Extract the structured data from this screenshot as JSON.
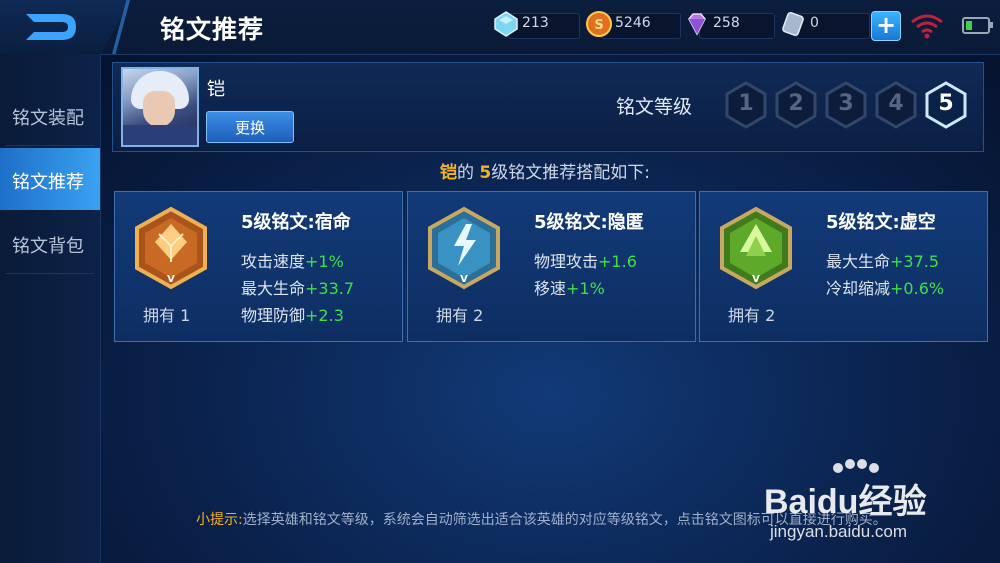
{
  "header": {
    "title": "铭文推荐",
    "resources": [
      {
        "icon": "diamond-icon",
        "value": "213"
      },
      {
        "icon": "gold-coin-icon",
        "value": "5246"
      },
      {
        "icon": "gem-icon",
        "value": "258"
      },
      {
        "icon": "voucher-icon",
        "value": "0"
      }
    ],
    "plus_label": "+"
  },
  "sidebar": {
    "items": [
      {
        "label": "铭文装配",
        "active": false
      },
      {
        "label": "铭文推荐",
        "active": true
      },
      {
        "label": "铭文背包",
        "active": false
      }
    ]
  },
  "hero": {
    "name": "铠",
    "change_label": "更换",
    "level_label": "铭文等级",
    "levels": [
      "1",
      "2",
      "3",
      "4",
      "5"
    ],
    "selected_level": "5"
  },
  "headline": {
    "hero": "铠",
    "middle": "的 ",
    "level": "5",
    "rest": "级铭文推荐搭配如下:"
  },
  "cards": [
    {
      "title": "5级铭文:宿命",
      "owned": "拥有 1",
      "emblem_color": "#e08a2a",
      "stats": [
        {
          "name": "攻击速度",
          "value": "+1%"
        },
        {
          "name": "最大生命",
          "value": "+33.7"
        },
        {
          "name": "物理防御",
          "value": "+2.3"
        }
      ]
    },
    {
      "title": "5级铭文:隐匿",
      "owned": "拥有 2",
      "emblem_color": "#4fb0d8",
      "stats": [
        {
          "name": "物理攻击",
          "value": "+1.6"
        },
        {
          "name": "移速",
          "value": "+1%"
        }
      ]
    },
    {
      "title": "5级铭文:虚空",
      "owned": "拥有 2",
      "emblem_color": "#7cc43a",
      "stats": [
        {
          "name": "最大生命",
          "value": "+37.5"
        },
        {
          "name": "冷却缩减",
          "value": "+0.6%"
        }
      ]
    }
  ],
  "tip": {
    "label": "小提示:",
    "text": "选择英雄和铭文等级，系统会自动筛选出适合该英雄的对应等级铭文，点击铭文图标可以直接进行购买。"
  },
  "watermark": {
    "logo": "Baidu经验",
    "url": "jingyan.baidu.com"
  },
  "colors": {
    "accent": "#f2b32a",
    "stat_value": "#3ee04a",
    "active_tab": "#2a8ae0"
  }
}
